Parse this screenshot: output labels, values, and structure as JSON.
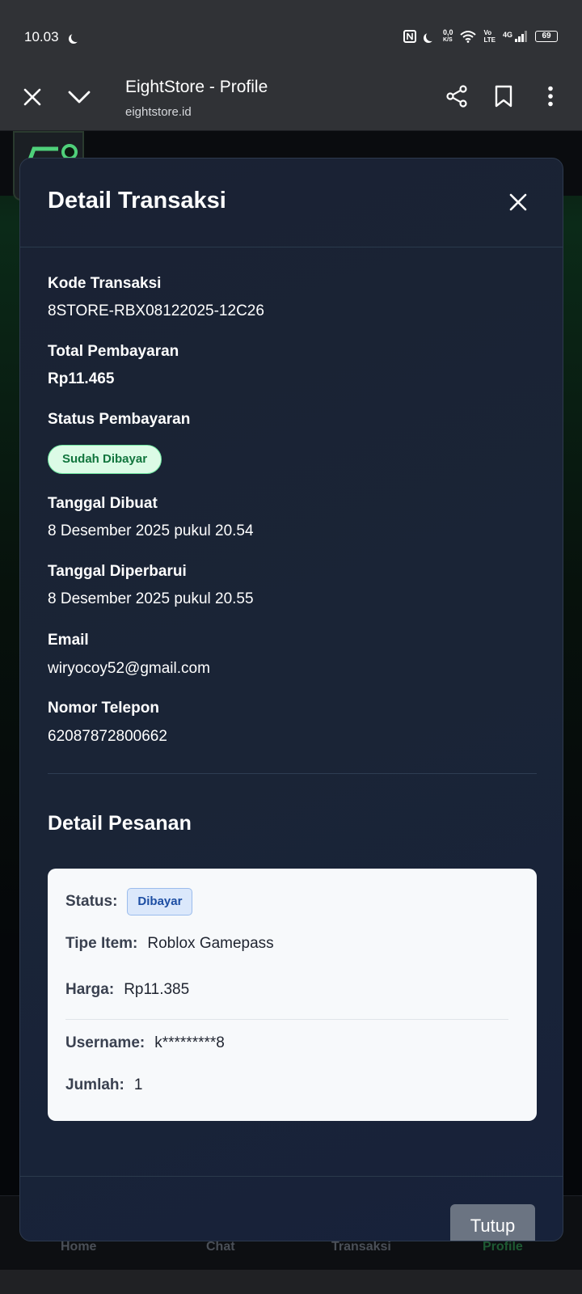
{
  "status_bar": {
    "time": "10.03",
    "net_speed_top": "0,0",
    "net_speed_bottom": "K/S",
    "volte_top": "Vo",
    "volte_bottom": "LTE",
    "network": "4G",
    "battery": "69"
  },
  "browser": {
    "title": "EightStore - Profile",
    "url": "eightstore.id",
    "icons": [
      "close-icon",
      "chevron-down-icon",
      "share-icon",
      "bookmark-icon",
      "more-vertical-icon"
    ]
  },
  "background_nav": {
    "items": [
      "Home",
      "Chat",
      "Transaksi",
      "Profile"
    ],
    "active": "Profile"
  },
  "modal": {
    "title": "Detail Transaksi",
    "fields": {
      "kode_label": "Kode Transaksi",
      "kode_value": "8STORE-RBX08122025-12C26",
      "total_label": "Total Pembayaran",
      "total_value": "Rp11.465",
      "status_label": "Status Pembayaran",
      "status_value": "Sudah Dibayar",
      "created_label": "Tanggal Dibuat",
      "created_value": "8 Desember 2025 pukul 20.54",
      "updated_label": "Tanggal Diperbarui",
      "updated_value": "8 Desember 2025 pukul 20.55",
      "email_label": "Email",
      "email_value": "wiryocoy52@gmail.com",
      "phone_label": "Nomor Telepon",
      "phone_value": "62087872800662"
    },
    "order": {
      "section_title": "Detail Pesanan",
      "status_label": "Status:",
      "status_value": "Dibayar",
      "type_label": "Tipe Item:",
      "type_value": "Roblox Gamepass",
      "price_label": "Harga:",
      "price_value": "Rp11.385",
      "username_label": "Username:",
      "username_value": "k*********8",
      "qty_label": "Jumlah:",
      "qty_value": "1"
    },
    "close_button": "Tutup"
  },
  "colors": {
    "modal_bg": "#1a2436",
    "paid_badge_bg": "#dcfbe6",
    "paid_badge_text": "#11753d",
    "order_badge_bg": "#dbe8fb",
    "order_badge_text": "#1d4ea3",
    "close_button_bg": "#6b7482"
  }
}
